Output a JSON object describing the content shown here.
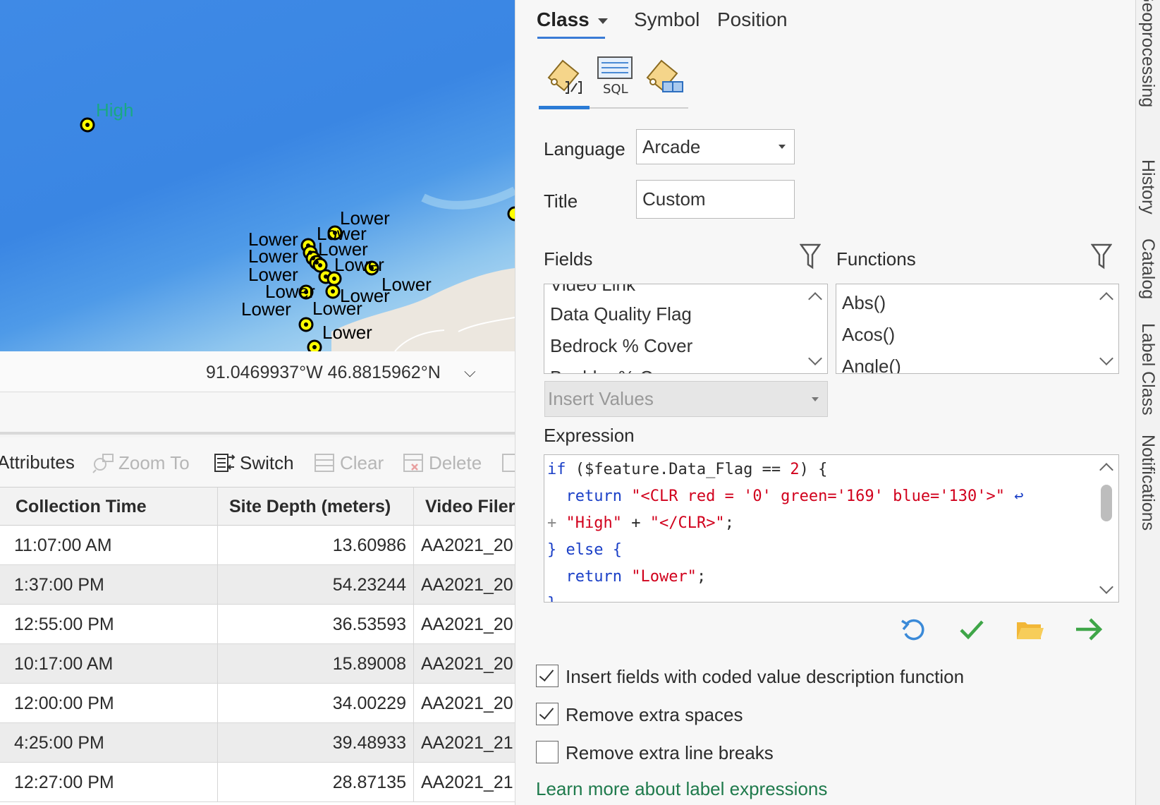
{
  "map": {
    "labels": {
      "high": "High",
      "lower": "Lower"
    },
    "coordinates": "91.0469937°W 46.8815962°N",
    "colors": {
      "water": "#3a86e3",
      "high_label": "#1aa884",
      "point_fill": "#ffff00"
    }
  },
  "attribute_table": {
    "toolbar": {
      "attributes": "Attributes",
      "zoom_to": "Zoom To",
      "switch": "Switch",
      "clear": "Clear",
      "delete": "Delete"
    },
    "columns": [
      "Collection Time",
      "Site Depth (meters)",
      "Video Filer"
    ],
    "rows": [
      {
        "time": "11:07:00 AM",
        "depth": "13.60986",
        "video": "AA2021_20"
      },
      {
        "time": "1:37:00 PM",
        "depth": "54.23244",
        "video": "AA2021_20"
      },
      {
        "time": "12:55:00 PM",
        "depth": "36.53593",
        "video": "AA2021_20"
      },
      {
        "time": "10:17:00 AM",
        "depth": "15.89008",
        "video": "AA2021_20"
      },
      {
        "time": "12:00:00 PM",
        "depth": "34.00229",
        "video": "AA2021_20"
      },
      {
        "time": "4:25:00 PM",
        "depth": "39.48933",
        "video": "AA2021_21"
      },
      {
        "time": "12:27:00 PM",
        "depth": "28.87135",
        "video": "AA2021_21"
      }
    ]
  },
  "label_panel": {
    "tabs": {
      "class": "Class",
      "symbol": "Symbol",
      "position": "Position"
    },
    "language_label": "Language",
    "language_value": "Arcade",
    "title_label": "Title",
    "title_value": "Custom",
    "fields_label": "Fields",
    "functions_label": "Functions",
    "fields_items": [
      "Video Link",
      "Data Quality Flag",
      "Bedrock % Cover",
      "Boulder % Cover"
    ],
    "functions_items": [
      "Abs()",
      "Acos()",
      "Angle()"
    ],
    "insert_values": "Insert Values",
    "expression_label": "Expression",
    "expression": {
      "l1_kw": "if",
      "l1_a": " ($feature.Data_Flag == ",
      "l1_num": "2",
      "l1_b": ") {",
      "l2_kw": "  return",
      "l2_str": " \"<CLR red = '0' green='169' blue='130'>\"",
      "l2_wrap": " ↩",
      "l3_plus": "+",
      "l3_str1": " \"High\"",
      "l3_op": " + ",
      "l3_str2": "\"</CLR>\"",
      "l3_end": ";",
      "l4_a": "} ",
      "l4_kw": "else",
      "l4_b": " {",
      "l5_kw": "  return",
      "l5_str": " \"Lower\"",
      "l5_end": ";",
      "l6": "}"
    },
    "checkboxes": [
      {
        "label": "Insert fields with coded value description function",
        "checked": true
      },
      {
        "label": "Remove extra spaces",
        "checked": true
      },
      {
        "label": "Remove extra line breaks",
        "checked": false
      }
    ],
    "learn_more": "Learn more about label expressions"
  },
  "dock_tabs": [
    "Geoprocessing",
    "History",
    "Catalog",
    "Label Class",
    "Notifications"
  ]
}
